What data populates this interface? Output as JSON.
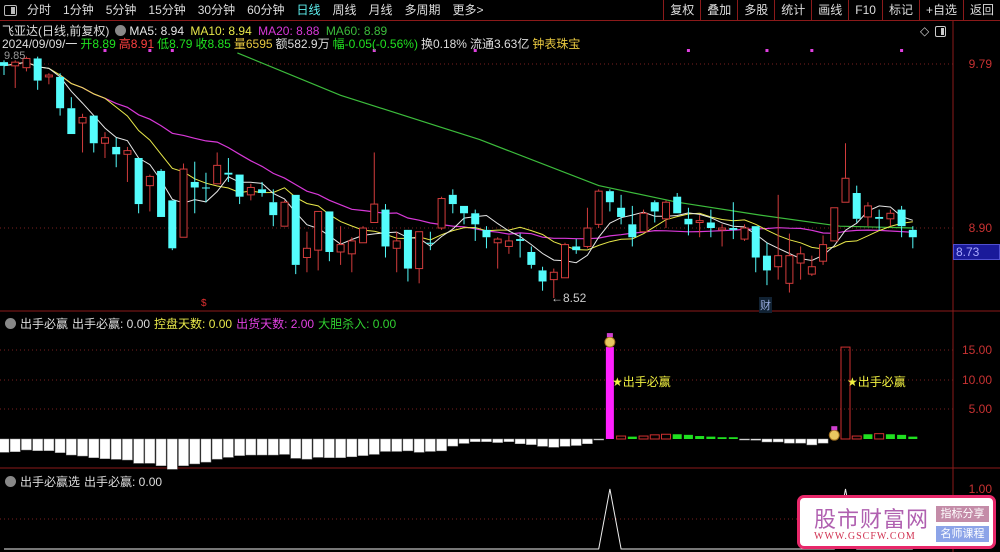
{
  "toolbar": {
    "tabs": [
      "分时",
      "1分钟",
      "5分钟",
      "15分钟",
      "30分钟",
      "60分钟",
      "日线",
      "周线",
      "月线",
      "多周期",
      "更多>"
    ],
    "active_tab": "日线",
    "right_buttons": [
      "复权",
      "叠加",
      "多股",
      "统计",
      "画线",
      "F10",
      "标记",
      "+自选",
      "返回"
    ]
  },
  "info": {
    "title": "飞亚达(日线,前复权)",
    "ma5": "MA5: 8.94",
    "ma10": "MA10: 8.94",
    "ma20": "MA20: 8.88",
    "ma60": "MA60: 8.89",
    "date": "2024/09/09/一",
    "open": "开8.89",
    "high": "高8.91",
    "low": "低8.79",
    "close": "收8.85",
    "volume": "量6595",
    "amount": "额582.9万",
    "change": "幅-0.05(-0.56%)",
    "turnover": "换0.18%",
    "float": "流通3.63亿",
    "sector": "钟表珠宝"
  },
  "colors": {
    "up": "#d23c3c",
    "down": "#54fcfc",
    "ma5": "#e6e6e6",
    "ma10": "#e8e84a",
    "ma20": "#d838d8",
    "ma60": "#3cbc3c",
    "axis": "#c83232"
  },
  "price_axis": {
    "labels": [
      "9.79",
      "8.90"
    ],
    "current": "8.73",
    "top_partial": "9.85"
  },
  "markers": {
    "low_label": "←8.52",
    "fin_label": "财",
    "event_label": "$"
  },
  "chart_data": [
    {
      "type": "candlestick",
      "title": "飞亚达 日线",
      "ylim": [
        8.45,
        9.95
      ],
      "fields": [
        "open",
        "close",
        "high",
        "low"
      ],
      "candles": [
        [
          9.8,
          9.78,
          9.81,
          9.73
        ],
        [
          9.78,
          9.8,
          9.81,
          9.66
        ],
        [
          9.77,
          9.82,
          9.83,
          9.75
        ],
        [
          9.82,
          9.7,
          9.83,
          9.65
        ],
        [
          9.72,
          9.73,
          9.74,
          9.68
        ],
        [
          9.72,
          9.55,
          9.74,
          9.51
        ],
        [
          9.55,
          9.41,
          9.61,
          9.41
        ],
        [
          9.47,
          9.5,
          9.52,
          9.31
        ],
        [
          9.51,
          9.36,
          9.51,
          9.31
        ],
        [
          9.36,
          9.39,
          9.42,
          9.28
        ],
        [
          9.34,
          9.3,
          9.39,
          9.23
        ],
        [
          9.3,
          9.32,
          9.34,
          9.15
        ],
        [
          9.28,
          9.03,
          9.28,
          8.98
        ],
        [
          9.13,
          9.18,
          9.19,
          8.99
        ],
        [
          9.21,
          8.96,
          9.22,
          8.96
        ],
        [
          9.05,
          8.79,
          9.05,
          8.78
        ],
        [
          8.85,
          9.22,
          9.25,
          8.85
        ],
        [
          9.15,
          9.12,
          9.26,
          8.98
        ],
        [
          9.12,
          9.12,
          9.2,
          9.04
        ],
        [
          9.14,
          9.24,
          9.31,
          9.14
        ],
        [
          9.2,
          9.19,
          9.28,
          9.15
        ],
        [
          9.19,
          9.07,
          9.19,
          9.03
        ],
        [
          9.08,
          9.12,
          9.14,
          9.05
        ],
        [
          9.11,
          9.09,
          9.15,
          9.07
        ],
        [
          9.04,
          8.97,
          9.11,
          8.91
        ],
        [
          8.91,
          9.04,
          9.05,
          8.91
        ],
        [
          9.08,
          8.7,
          9.08,
          8.65
        ],
        [
          8.74,
          8.79,
          8.88,
          8.66
        ],
        [
          8.78,
          8.99,
          8.99,
          8.67
        ],
        [
          8.99,
          8.77,
          8.99,
          8.72
        ],
        [
          8.77,
          8.81,
          8.91,
          8.7
        ],
        [
          8.76,
          8.83,
          8.85,
          8.66
        ],
        [
          8.82,
          8.9,
          8.91,
          8.82
        ],
        [
          8.93,
          9.03,
          9.31,
          8.93
        ],
        [
          9.0,
          8.8,
          9.03,
          8.74
        ],
        [
          8.79,
          8.83,
          8.88,
          8.66
        ],
        [
          8.89,
          8.68,
          8.89,
          8.61
        ],
        [
          8.68,
          8.88,
          8.88,
          8.6
        ],
        [
          8.82,
          8.82,
          8.88,
          8.78
        ],
        [
          8.9,
          9.06,
          9.07,
          8.89
        ],
        [
          9.08,
          9.03,
          9.11,
          8.98
        ],
        [
          9.02,
          8.98,
          9.02,
          8.92
        ],
        [
          8.98,
          8.92,
          9.0,
          8.83
        ],
        [
          8.89,
          8.85,
          8.91,
          8.79
        ],
        [
          8.82,
          8.84,
          8.85,
          8.68
        ],
        [
          8.8,
          8.83,
          8.86,
          8.76
        ],
        [
          8.84,
          8.83,
          8.87,
          8.74
        ],
        [
          8.77,
          8.7,
          8.8,
          8.68
        ],
        [
          8.67,
          8.61,
          8.69,
          8.56
        ],
        [
          8.62,
          8.66,
          8.68,
          8.52
        ],
        [
          8.63,
          8.81,
          8.82,
          8.63
        ],
        [
          8.8,
          8.78,
          8.84,
          8.76
        ],
        [
          8.8,
          8.9,
          9.01,
          8.79
        ],
        [
          8.92,
          9.1,
          9.11,
          8.9
        ],
        [
          9.1,
          9.04,
          9.11,
          8.99
        ],
        [
          9.01,
          8.96,
          9.08,
          8.92
        ],
        [
          8.92,
          8.85,
          9.02,
          8.8
        ],
        [
          8.88,
          8.98,
          9.0,
          8.88
        ],
        [
          9.04,
          8.99,
          9.05,
          8.93
        ],
        [
          8.95,
          9.04,
          9.05,
          8.9
        ],
        [
          9.07,
          8.98,
          9.09,
          8.98
        ],
        [
          8.95,
          8.92,
          9.01,
          8.86
        ],
        [
          8.93,
          8.94,
          8.97,
          8.85
        ],
        [
          8.93,
          8.9,
          9.0,
          8.85
        ],
        [
          8.89,
          8.9,
          8.92,
          8.8
        ],
        [
          8.9,
          8.89,
          9.04,
          8.84
        ],
        [
          8.84,
          8.9,
          8.92,
          8.83
        ],
        [
          8.91,
          8.74,
          8.91,
          8.66
        ],
        [
          8.75,
          8.67,
          8.82,
          8.59
        ],
        [
          8.69,
          8.75,
          9.08,
          8.62
        ],
        [
          8.6,
          8.75,
          8.87,
          8.55
        ],
        [
          8.71,
          8.76,
          8.8,
          8.62
        ],
        [
          8.65,
          8.69,
          8.75,
          8.64
        ],
        [
          8.72,
          8.81,
          8.86,
          8.7
        ],
        [
          8.83,
          9.01,
          9.01,
          8.83
        ],
        [
          9.04,
          9.17,
          9.36,
          9.04
        ],
        [
          9.09,
          8.95,
          9.13,
          8.93
        ],
        [
          8.96,
          9.02,
          9.04,
          8.91
        ],
        [
          8.96,
          8.95,
          9.0,
          8.89
        ],
        [
          8.95,
          8.98,
          9.0,
          8.91
        ],
        [
          9.0,
          8.91,
          9.02,
          8.85
        ],
        [
          8.89,
          8.85,
          8.91,
          8.79
        ]
      ],
      "ma60_points": [
        [
          20.8,
          9.85
        ],
        [
          30,
          9.62
        ],
        [
          42.4,
          9.38
        ],
        [
          53,
          9.13
        ],
        [
          60,
          9.04
        ],
        [
          67.4,
          8.97
        ],
        [
          74.5,
          8.91
        ],
        [
          81,
          8.9
        ]
      ],
      "event_dots_at": [
        9,
        13,
        15,
        33,
        42,
        61,
        68,
        72,
        80
      ],
      "low_marker_index": 49,
      "fin_marker_index": 68,
      "event_marker_index": 18
    },
    {
      "type": "bar",
      "title": "出手必赢",
      "ylim": [
        -6,
        19
      ],
      "ticks": [
        "15.00",
        "10.00",
        "5.00"
      ],
      "values": [
        -2.25,
        -2.14,
        -1.85,
        -1.97,
        -1.97,
        -2.3,
        -2.7,
        -2.87,
        -3.15,
        -3.32,
        -3.43,
        -3.54,
        -4.1,
        -4.1,
        -4.5,
        -5.1,
        -4.5,
        -4.2,
        -3.9,
        -3.4,
        -3.1,
        -2.8,
        -2.7,
        -2.7,
        -2.7,
        -2.6,
        -3.26,
        -3.4,
        -3.1,
        -3.15,
        -3.15,
        -3.0,
        -2.8,
        -2.6,
        -2.1,
        -2.1,
        -2.0,
        -2.25,
        -2.1,
        -2.0,
        -1.2,
        -0.75,
        -0.45,
        -0.45,
        -0.6,
        -0.45,
        -0.8,
        -0.95,
        -1.24,
        -1.4,
        -1.24,
        -1.1,
        -0.8,
        -0.1,
        15.5,
        0.5,
        0.4,
        0.5,
        0.7,
        0.8,
        0.8,
        0.7,
        0.5,
        0.4,
        0.3,
        0.3,
        0.2,
        -0.2,
        -0.5,
        -0.5,
        -0.7,
        -0.7,
        -1.0,
        -0.7,
        -0.2,
        15.5,
        0.5,
        0.8,
        0.9,
        0.8,
        0.7,
        0.4
      ],
      "kinds": "wwwwwwwwwwwwwwwwwwwwwwwwwwwwwwwwwwwwwwwwwwwwwwwwwwwwwwmrgrrrggggggwwwwwwwwmrrgrgg",
      "header": {
        "name": "出手必赢",
        "v1": "出手必赢: 0.00",
        "v2": "控盘天数: 0.00",
        "v3": "出货天数: 2.00",
        "v4": "大胆杀入: 0.00"
      },
      "signal_label": "★出手必赢"
    },
    {
      "type": "line",
      "title": "出手必赢选",
      "ylim": [
        0,
        1
      ],
      "ticks": [
        "1.00"
      ],
      "spikes_at": [
        54,
        75
      ],
      "header": {
        "name": "出手必赢选",
        "v1": "出手必赢: 0.00"
      }
    }
  ],
  "watermark": {
    "title": "股市财富网",
    "url": "WWW.GSCFW.COM",
    "tag1": "指标分享",
    "tag2": "名师课程"
  }
}
